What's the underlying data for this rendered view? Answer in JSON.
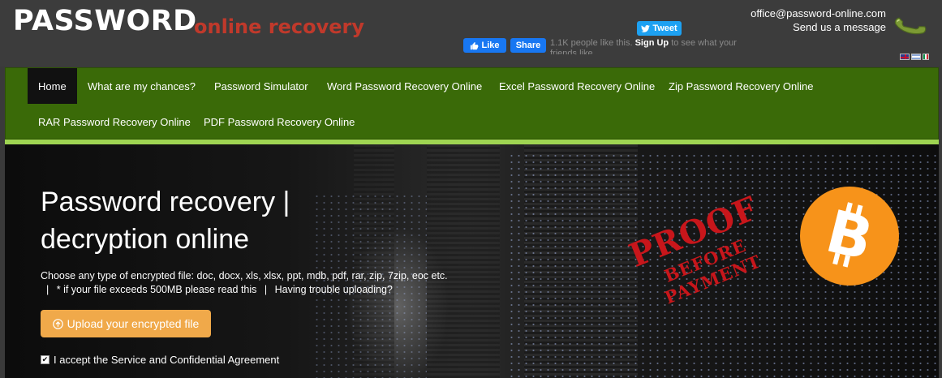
{
  "header": {
    "logo_main": "PASSWORD",
    "logo_sub": "online recovery",
    "tweet_label": "Tweet",
    "fb_like_label": "Like",
    "fb_share_label": "Share",
    "fb_text_before": "1.1K people like this. ",
    "fb_text_signup": "Sign Up",
    "fb_text_after": " to see what your friends like.",
    "email": "office@password-online.com",
    "send_message": "Send us a message",
    "phone_icon": "phone-icon",
    "flags": [
      "en",
      "de",
      "it"
    ]
  },
  "nav": {
    "items": [
      {
        "label": "Home",
        "active": true
      },
      {
        "label": "What are my chances?"
      },
      {
        "label": "Password Simulator"
      },
      {
        "label": "Word Password Recovery Online"
      },
      {
        "label": "Excel Password Recovery Online"
      },
      {
        "label": "Zip Password Recovery Online"
      },
      {
        "label": "RAR Password Recovery Online"
      },
      {
        "label": "PDF Password Recovery Online"
      }
    ]
  },
  "hero": {
    "title_line1": "Password recovery |",
    "title_line2": "decryption online",
    "description": "Choose any type of encrypted file: doc, docx, xls, xlsx, ppt, mdb, pdf, rar, zip, 7zip, eoc etc.",
    "link_sep": "|",
    "link_large_file": "* if your file exceeds 500MB please read this",
    "link_trouble": "Having trouble uploading?",
    "upload_label": "Upload your encrypted file",
    "accept_label": "I accept the Service and Confidential Agreement",
    "accept_checked": true,
    "stamp_line1": "PROOF",
    "stamp_line2": "BEFORE",
    "stamp_line3": "PAYMENT",
    "bitcoin_icon": "bitcoin-icon"
  },
  "colors": {
    "nav_bg": "#3a6a08",
    "nav_accent": "#9fd552",
    "logo_sub": "#c0392b",
    "upload_btn": "#f0a94a",
    "stamp": "#c8161b",
    "bitcoin": "#f7931a"
  }
}
